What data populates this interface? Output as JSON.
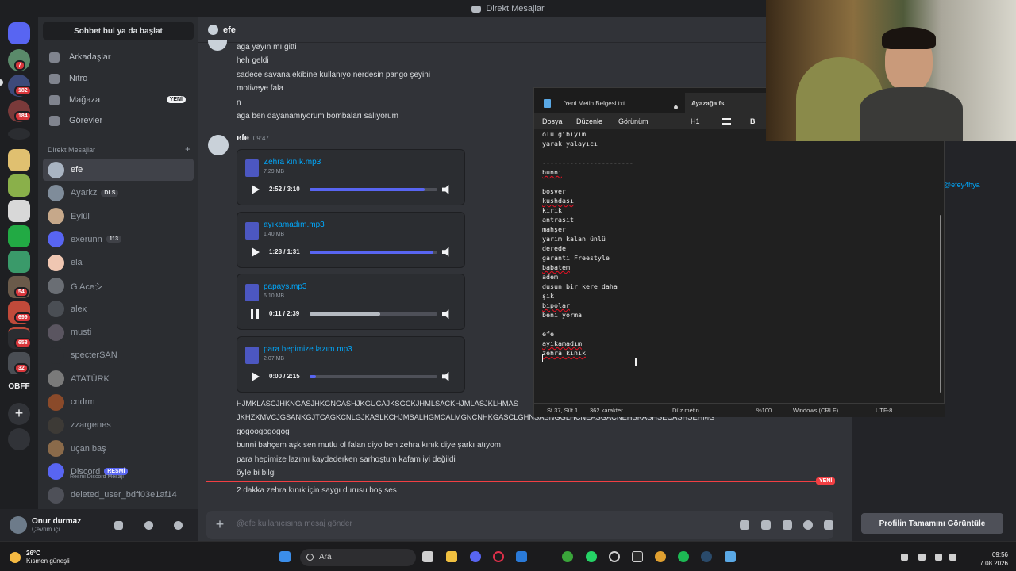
{
  "window": {
    "title": "Direkt Mesajlar"
  },
  "sidebar": {
    "find_button": "Sohbet bul ya da başlat",
    "nav": [
      {
        "label": "Arkadaşlar"
      },
      {
        "label": "Nitro"
      },
      {
        "label": "Mağaza",
        "badge": "YENİ"
      },
      {
        "label": "Görevler"
      }
    ],
    "dm_header": "Direkt Mesajlar",
    "dm_add": "+",
    "dms": [
      {
        "name": "efe",
        "tag": "",
        "color": "#a9b4c2"
      },
      {
        "name": "Ayarkz",
        "tag": "DLS",
        "color": "#7f8c9a"
      },
      {
        "name": "Eylül",
        "tag": "",
        "color": "#c6a88a"
      },
      {
        "name": "exerunn",
        "tag": "113",
        "color": "#5865f2"
      },
      {
        "name": "ela",
        "tag": "",
        "color": "#f0c7b2"
      },
      {
        "name": "G Aceシ",
        "tag": "",
        "color": "#6a6e74"
      },
      {
        "name": "alex",
        "tag": "",
        "color": "#4a4e54"
      },
      {
        "name": "musti",
        "tag": "",
        "color": "#5a5560"
      },
      {
        "name": "specterSAN",
        "tag": "",
        "color": "#2b2d31"
      },
      {
        "name": "ATATÜRK",
        "tag": "",
        "color": "#7a7a7a"
      },
      {
        "name": "cndrm",
        "tag": "",
        "color": "#8a4a2a"
      },
      {
        "name": "zzargenes",
        "tag": "",
        "color": "#3d3a36"
      },
      {
        "name": "uçan baş",
        "tag": "",
        "color": "#8a6a4a"
      },
      {
        "name": "Discord",
        "tag": "RESMİ",
        "sub": "Resmi Discord Mesajı",
        "color": "#5865f2"
      },
      {
        "name": "deleted_user_bdff03e1af14",
        "tag": "",
        "color": "#4e5058"
      }
    ]
  },
  "servers": {
    "badges": [
      "7",
      "182",
      "184",
      "54",
      "699",
      "658",
      "32"
    ],
    "text_label": "OBFF"
  },
  "user": {
    "name": "Onur durmaz",
    "status": "Çevrim içi"
  },
  "chat": {
    "channel": "efe",
    "early_lines": [
      "aga yayın mı gitti",
      "heh geldi",
      "sadece savana ekibine kullanıyo nerdesin pango şeyini",
      "motiveye fala",
      "n",
      "aga ben dayanamıyorum bombaları salıyorum"
    ],
    "author": "efe",
    "timestamp": "09:47",
    "attachments": [
      {
        "name": "Zehra kınık.mp3",
        "size": "7.29 MB",
        "time": "2:52 / 3:10",
        "progress": 0.9,
        "playing": false
      },
      {
        "name": "ayıkamadım.mp3",
        "size": "1.40 MB",
        "time": "1:28 / 1:31",
        "progress": 0.97,
        "playing": false
      },
      {
        "name": "papays.mp3",
        "size": "6.10 MB",
        "time": "0:11 / 2:39",
        "progress": 0.55,
        "playing": true
      },
      {
        "name": "para hepimize lazım.mp3",
        "size": "2.07 MB",
        "time": "0:00 / 2:15",
        "progress": 0.05,
        "playing": false
      }
    ],
    "late_lines": [
      "HJMKLASCJHKNGASJHKGNCASHJKGUCAJKSGCKJHMLSACKHJMLASJKLHMAS",
      "JKHZXMVCJGSANKGJTCAGKCNLGJKASLKCHJMSALHGMCALMGNCNHKGASCLGHNSASNGGLHCNEASGACNEHSKASHSECASHSEHMG",
      "gogoogogogog",
      "bunni bahçem aşk sen mutlu ol falan diyo ben zehra kınık diye şarkı atıyom",
      "para hepimize lazımı kaydederken sarhoştum kafam iyi değildi",
      "öyle bi bilgi"
    ],
    "new_label": "YENİ",
    "after_new": "2 dakka zehra kınık için saygı durusu boş ses",
    "placeholder": "@efe kullanıcısına mesaj gönder"
  },
  "profile": {
    "handle": "@efey4hya",
    "full_button": "Profilin Tamamını Görüntüle"
  },
  "notepad": {
    "tab1": "Yeni Metin Belgesi.txt",
    "tab2": "Ayazağa fs",
    "menu": [
      "Dosya",
      "Düzenle",
      "Görünüm"
    ],
    "heading": "H1",
    "bold": "B",
    "lines": [
      "ölü gibiyim",
      "yarak yalayıcı",
      "",
      "-----------------------",
      "bunni",
      "",
      "bosver",
      "kushdası",
      "kırık",
      "antrasit",
      "mahşer",
      "yarım kalan ünlü",
      "derede",
      "garanti Freestyle",
      "babatem",
      "adem",
      "dusun bir kere daha",
      "şık",
      "bipolar",
      "beni yorma",
      "",
      "efe",
      "ayıkamadım",
      "zehra kınık"
    ],
    "status": {
      "position": "St 37, Süt 1",
      "chars": "362 karakter",
      "mode": "Düz metin",
      "zoom": "%100",
      "eol": "Windows (CRLF)",
      "enc": "UTF-8"
    }
  },
  "taskbar": {
    "temp": "26°C",
    "weather": "Kısmen güneşli",
    "search": "Ara",
    "time": "09:56",
    "date": "7.08.2026"
  }
}
